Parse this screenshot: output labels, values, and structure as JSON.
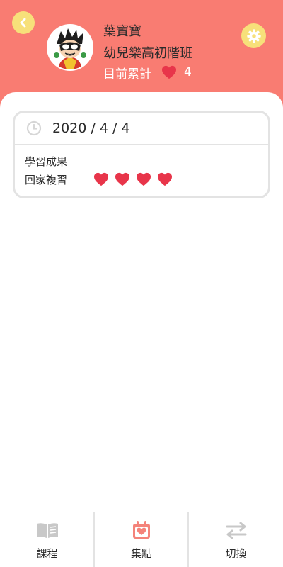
{
  "header": {
    "student_name": "葉寶寶",
    "class_name": "幼兒樂高初階班",
    "total_label": "目前累計",
    "total_count": "4"
  },
  "record": {
    "date": "2020 / 4 / 4",
    "section_title": "學習成果",
    "review_label": "回家複習",
    "review_hearts": 4
  },
  "nav": {
    "items": [
      {
        "label": "課程",
        "icon": "book-icon",
        "active": false
      },
      {
        "label": "集點",
        "icon": "calendar-heart-icon",
        "active": true
      },
      {
        "label": "切換",
        "icon": "swap-arrows-icon",
        "active": false
      }
    ]
  },
  "colors": {
    "header_bg": "#f97c72",
    "button_yellow": "#f7e07a",
    "heart_red": "#e8354a",
    "nav_active": "#f4837a",
    "nav_inactive": "#c8c8c8"
  }
}
